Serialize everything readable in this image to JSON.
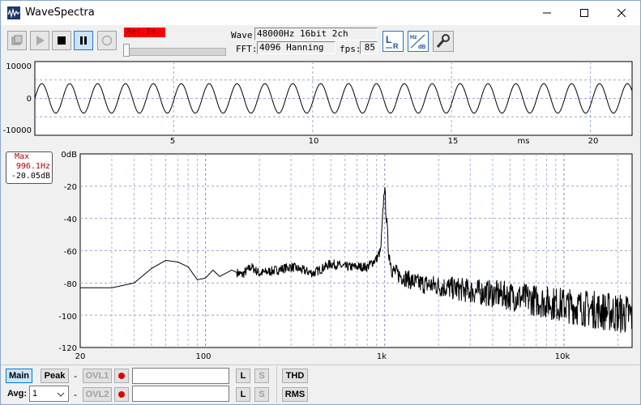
{
  "window": {
    "title": "WaveSpectra"
  },
  "toolbar": {
    "rec_status": "Rec.In.",
    "wave_label": "Wave:",
    "wave_value": "48000Hz 16bit 2ch",
    "fft_label": "FFT:",
    "fft_value": "4096 Hanning",
    "fps_label": "fps:",
    "fps_value": "85"
  },
  "waveform": {
    "y_ticks": [
      "10000",
      "0",
      "-10000"
    ],
    "x_ticks": [
      "5",
      "10",
      "15",
      "20"
    ],
    "x_unit": "ms"
  },
  "spectrum": {
    "y_ticks": [
      "0dB",
      "-20",
      "-40",
      "-60",
      "-80",
      "-100",
      "-120"
    ],
    "x_ticks": [
      "20",
      "100",
      "1k",
      "10k"
    ],
    "peak": {
      "title": "Max",
      "freq": "996.1Hz",
      "level": "-20.05dB"
    }
  },
  "chart_data": [
    {
      "type": "line",
      "x": [
        0,
        21.5
      ],
      "xlim": [
        0,
        21.5
      ],
      "ylim": [
        -10000,
        10000
      ],
      "series": [
        {
          "values": [
            0,
            0
          ],
          "frequency_hz": 996.1,
          "amplitude": 4000
        }
      ],
      "grid": true
    },
    {
      "type": "line",
      "xscale": "log",
      "xlim": [
        20,
        24000
      ],
      "ylim": [
        -120,
        0
      ],
      "grid": true,
      "series": [
        {
          "x": [
            20,
            30,
            40,
            50,
            60,
            70,
            80,
            90,
            100,
            110,
            120,
            140,
            160,
            180,
            200,
            250,
            300,
            400,
            500,
            600,
            800,
            900,
            950,
            996,
            1050,
            1100,
            1200,
            1500,
            2000,
            3000,
            5000,
            8000,
            12000,
            18000,
            24000
          ],
          "values": [
            -83,
            -83,
            -80,
            -71,
            -66,
            -67,
            -70,
            -78,
            -77,
            -72,
            -76,
            -72,
            -75,
            -70,
            -74,
            -72,
            -70,
            -74,
            -68,
            -70,
            -70,
            -65,
            -60,
            -20,
            -60,
            -72,
            -75,
            -80,
            -82,
            -85,
            -88,
            -92,
            -95,
            -98,
            -100
          ]
        }
      ]
    }
  ],
  "bottom": {
    "main_label": "Main",
    "peak_label": "Peak",
    "dash": "-",
    "ovl1_label": "OVL1",
    "ovl2_label": "OVL2",
    "avg_label": "Avg:",
    "avg_value": "1",
    "l_label": "L",
    "s_label": "S",
    "thd_label": "THD",
    "rms_label": "RMS"
  },
  "colors": {
    "accent": "#0078d7",
    "rec": "#ff0000",
    "peak_box": "#b00000"
  }
}
